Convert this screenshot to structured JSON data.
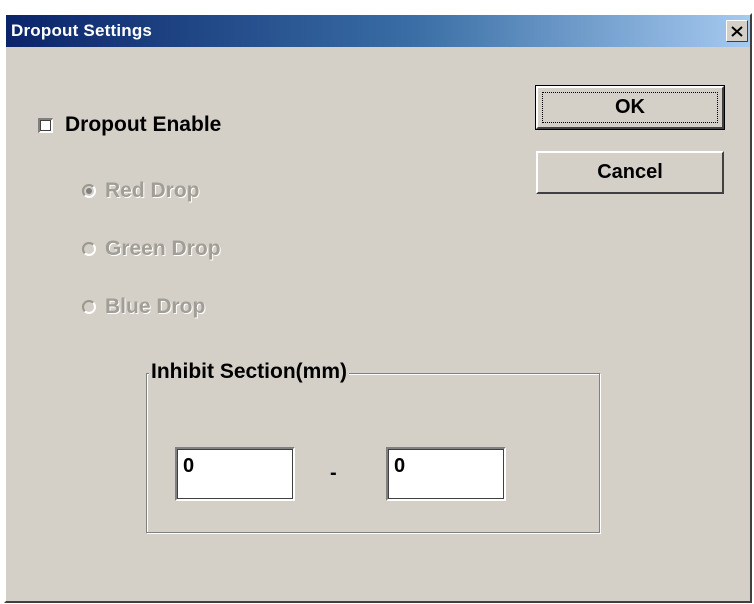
{
  "window": {
    "title": "Dropout Settings",
    "close_icon": "close-icon"
  },
  "dropout_enable": {
    "label": "Dropout Enable",
    "checked": false
  },
  "drop_options": [
    {
      "label": "Red Drop",
      "selected": true,
      "enabled": false
    },
    {
      "label": "Green Drop",
      "selected": false,
      "enabled": false
    },
    {
      "label": "Blue Drop",
      "selected": false,
      "enabled": false
    }
  ],
  "buttons": {
    "ok_label": "OK",
    "cancel_label": "Cancel"
  },
  "inhibit_section": {
    "legend": "Inhibit Section(mm)",
    "from_value": "0",
    "separator": "-",
    "to_value": "0"
  },
  "colors": {
    "face": "#d4d0c8",
    "title_start": "#0a246a",
    "title_end": "#a6caf0",
    "disabled_text": "#a19e96"
  }
}
